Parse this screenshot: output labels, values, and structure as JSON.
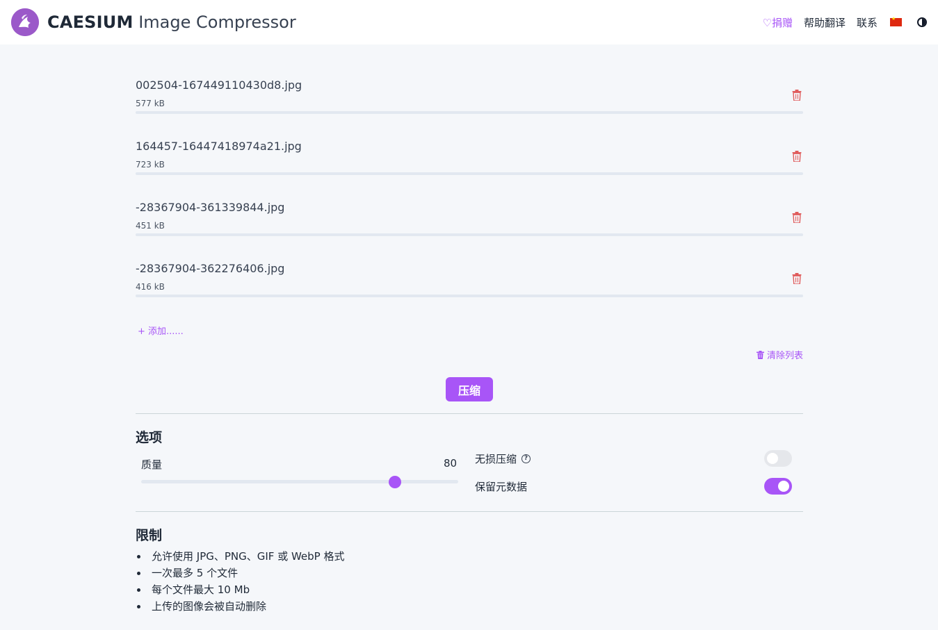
{
  "header": {
    "brand_bold": "CAESIUM",
    "brand_rest": " Image Compressor",
    "nav": {
      "donate": "♡捐赠",
      "help_translate": "帮助翻译",
      "contact": "联系"
    },
    "language_flag": "china-flag-icon",
    "theme_toggle_icon": "contrast-icon"
  },
  "files": [
    {
      "name": "002504-167449110430d8.jpg",
      "size": "577 kB",
      "progress": 0
    },
    {
      "name": "164457-16447418974a21.jpg",
      "size": "723 kB",
      "progress": 0
    },
    {
      "name": "-28367904-361339844.jpg",
      "size": "451 kB",
      "progress": 0
    },
    {
      "name": "-28367904-362276406.jpg",
      "size": "416 kB",
      "progress": 0
    }
  ],
  "actions": {
    "add": "+ 添加......",
    "clear": "清除列表",
    "compress": "压缩"
  },
  "options": {
    "title": "选项",
    "quality_label": "质量",
    "quality_value": "80",
    "quality_fraction": 0.8,
    "lossless_label": "无损压缩",
    "lossless_on": false,
    "keep_metadata_label": "保留元数据",
    "keep_metadata_on": true
  },
  "limits": {
    "title": "限制",
    "items": [
      "允许使用 JPG、PNG、GIF 或 WebP 格式",
      "一次最多 5 个文件",
      "每个文件最大 10 Mb",
      "上传的图像会被自动删除"
    ]
  },
  "colors": {
    "accent": "#a855f7",
    "trash": "#e05c5c",
    "background": "#f5f7fa"
  }
}
